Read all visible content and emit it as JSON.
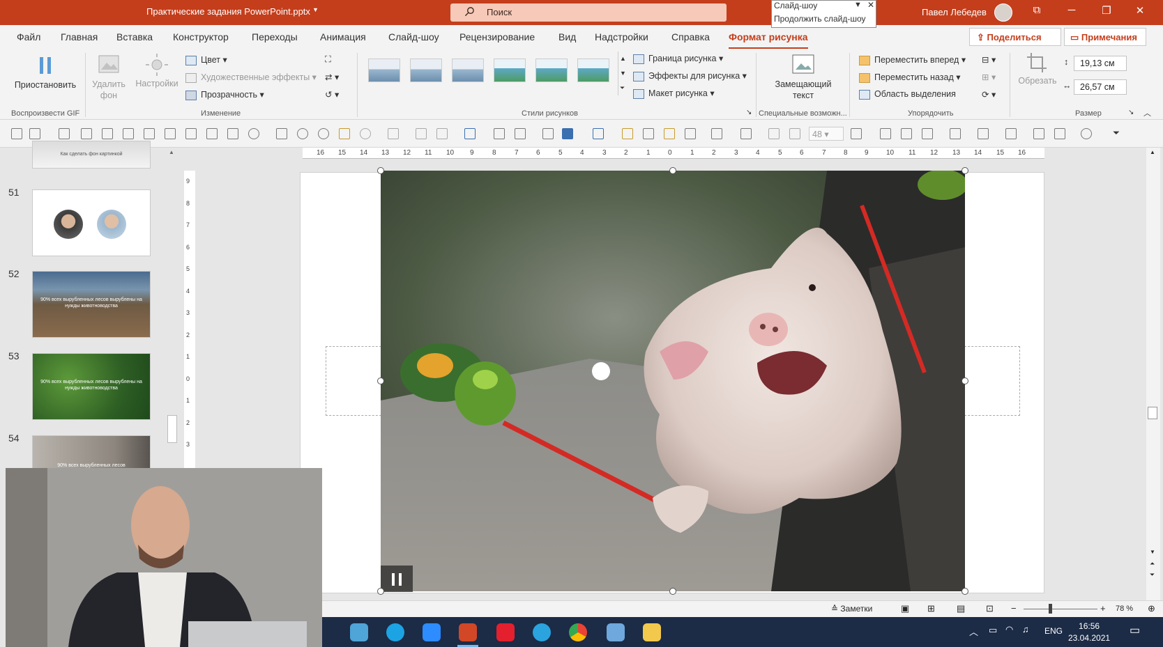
{
  "titlebar": {
    "file_name": "Практические задания PowerPoint.pptx",
    "search_placeholder": "Поиск",
    "user_name": "Павел Лебедев",
    "popup_line1": "Слайд-шоу",
    "popup_line2": "Продолжить слайд-шоу"
  },
  "menu": {
    "tabs": [
      "Файл",
      "Главная",
      "Вставка",
      "Конструктор",
      "Переходы",
      "Анимация",
      "Слайд-шоу",
      "Рецензирование",
      "Вид",
      "Надстройки",
      "Справка",
      "Формат рисунка"
    ],
    "active_tab": "Формат рисунка",
    "share_label": "Поделиться",
    "notes_label": "Примечания"
  },
  "ribbon": {
    "gif": {
      "pause_label": "Приостановить",
      "group": "Воспроизвести GIF"
    },
    "adjust": {
      "remove_bg": "Удалить фон",
      "settings": "Настройки",
      "color": "Цвет",
      "art_effects": "Художественные эффекты",
      "transparency": "Прозрачность",
      "group": "Изменение"
    },
    "styles": {
      "border": "Граница рисунка",
      "effects": "Эффекты для рисунка",
      "layout": "Макет рисунка",
      "group": "Стили рисунков"
    },
    "accessibility": {
      "alt_text": "Замещающий текст",
      "group": "Специальные возможн..."
    },
    "arrange": {
      "bring_forward": "Переместить вперед",
      "send_backward": "Переместить назад",
      "selection_pane": "Область выделения",
      "group": "Упорядочить"
    },
    "size": {
      "crop": "Обрезать",
      "height": "19,13 см",
      "width": "26,57 см",
      "group": "Размер"
    }
  },
  "qat": {
    "font_size": "48"
  },
  "slides": [
    {
      "number": "",
      "caption": "Как сделать фон картинкой"
    },
    {
      "number": "51",
      "caption": ""
    },
    {
      "number": "52",
      "caption": "90% всех вырубленных лесов вырублены на нужды животноводства"
    },
    {
      "number": "53",
      "caption": "90% всех вырубленных лесов вырублены на нужды животноводства"
    },
    {
      "number": "54",
      "caption": "90% всех вырубленных лесов"
    }
  ],
  "ruler": {
    "h_ticks": [
      "16",
      "15",
      "14",
      "13",
      "12",
      "11",
      "10",
      "9",
      "8",
      "7",
      "6",
      "5",
      "4",
      "3",
      "2",
      "1",
      "0",
      "1",
      "2",
      "3",
      "4",
      "5",
      "6",
      "7",
      "8",
      "9",
      "10",
      "11",
      "12",
      "13",
      "14",
      "15",
      "16"
    ],
    "v_ticks": [
      "9",
      "8",
      "7",
      "6",
      "5",
      "4",
      "3",
      "2",
      "1",
      "0",
      "1",
      "2",
      "3"
    ]
  },
  "statusbar": {
    "notes": "Заметки",
    "zoom": "78 %"
  },
  "taskbar": {
    "lang": "ENG",
    "time": "16:56",
    "date": "23.04.2021"
  },
  "colors": {
    "accent": "#c43e1c",
    "taskbar": "#1c2b46"
  }
}
